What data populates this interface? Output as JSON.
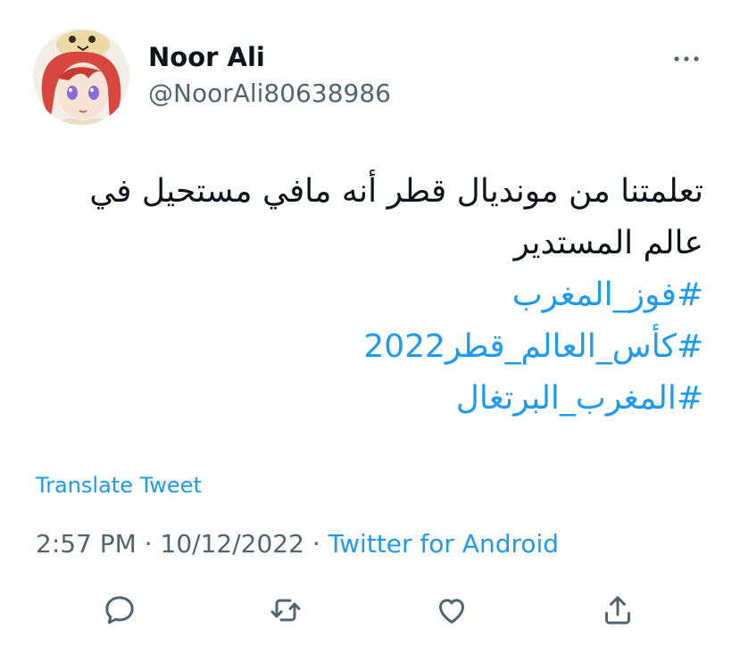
{
  "author": {
    "name": "Noor Ali",
    "handle": "@NoorAli80638986"
  },
  "tweet": {
    "lines": [
      "تعلمتنا من مونديال قطر أنه مافي مستحيل في",
      "عالم المستدير"
    ],
    "hashtags": [
      "#فوز_المغرب",
      "#كأس_العالم_قطر2022",
      "#المغرب_البرتغال"
    ]
  },
  "translate_label": "Translate Tweet",
  "meta": {
    "time": "2:57 PM",
    "separator": "·",
    "date": "10/12/2022",
    "source": "Twitter for Android"
  },
  "icons": {
    "more": "more-dots-icon",
    "reply": "reply-icon",
    "retweet": "retweet-icon",
    "like": "like-icon",
    "share": "share-icon"
  },
  "colors": {
    "link": "#1d9bf0",
    "text": "#0f1419",
    "secondary": "#536471",
    "icon": "#536471",
    "avatar_hair": "#d8473f",
    "avatar_eyes": "#8a6cd6"
  }
}
